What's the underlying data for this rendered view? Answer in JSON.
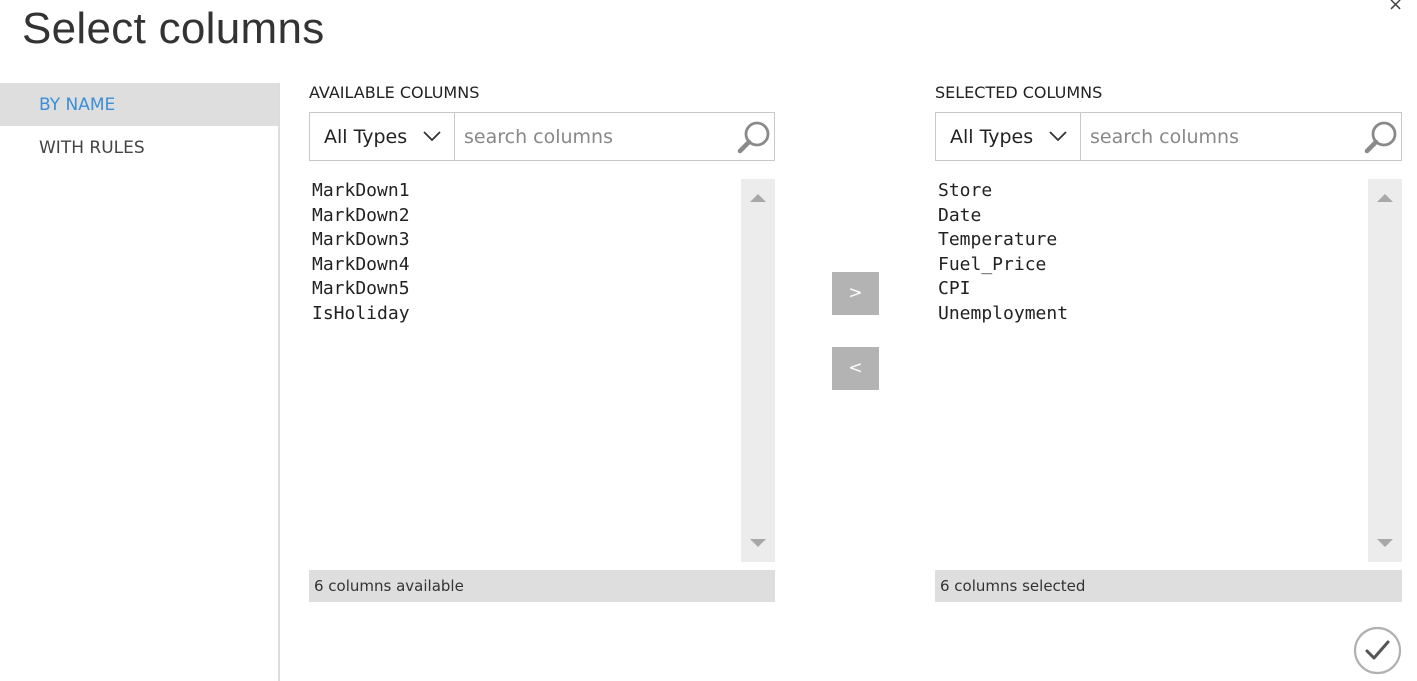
{
  "dialog": {
    "title": "Select columns",
    "close_label": "×"
  },
  "sidebar": {
    "items": [
      {
        "label": "BY NAME"
      },
      {
        "label": "WITH RULES"
      }
    ]
  },
  "available": {
    "header": "AVAILABLE COLUMNS",
    "type_filter": "All Types",
    "search_placeholder": "search columns",
    "items": [
      "MarkDown1",
      "MarkDown2",
      "MarkDown3",
      "MarkDown4",
      "MarkDown5",
      "IsHoliday"
    ],
    "status": "6 columns available"
  },
  "selected": {
    "header": "SELECTED COLUMNS",
    "type_filter": "All Types",
    "search_placeholder": "search columns",
    "items": [
      "Store",
      "Date",
      "Temperature",
      "Fuel_Price",
      "CPI",
      "Unemployment"
    ],
    "status": "6 columns selected"
  },
  "actions": {
    "add_label": ">",
    "remove_label": "<"
  },
  "icons": {
    "close": "close-icon",
    "chevron": "chevron-down-icon",
    "search": "search-icon",
    "scroll_up": "scroll-up-icon",
    "scroll_down": "scroll-down-icon",
    "ok": "checkmark-icon"
  },
  "colors": {
    "accent": "#3b8ed8",
    "selected_tab_bg": "#dedede",
    "button_bg": "#b3b3b3",
    "scrollbar_bg": "#ececec"
  }
}
